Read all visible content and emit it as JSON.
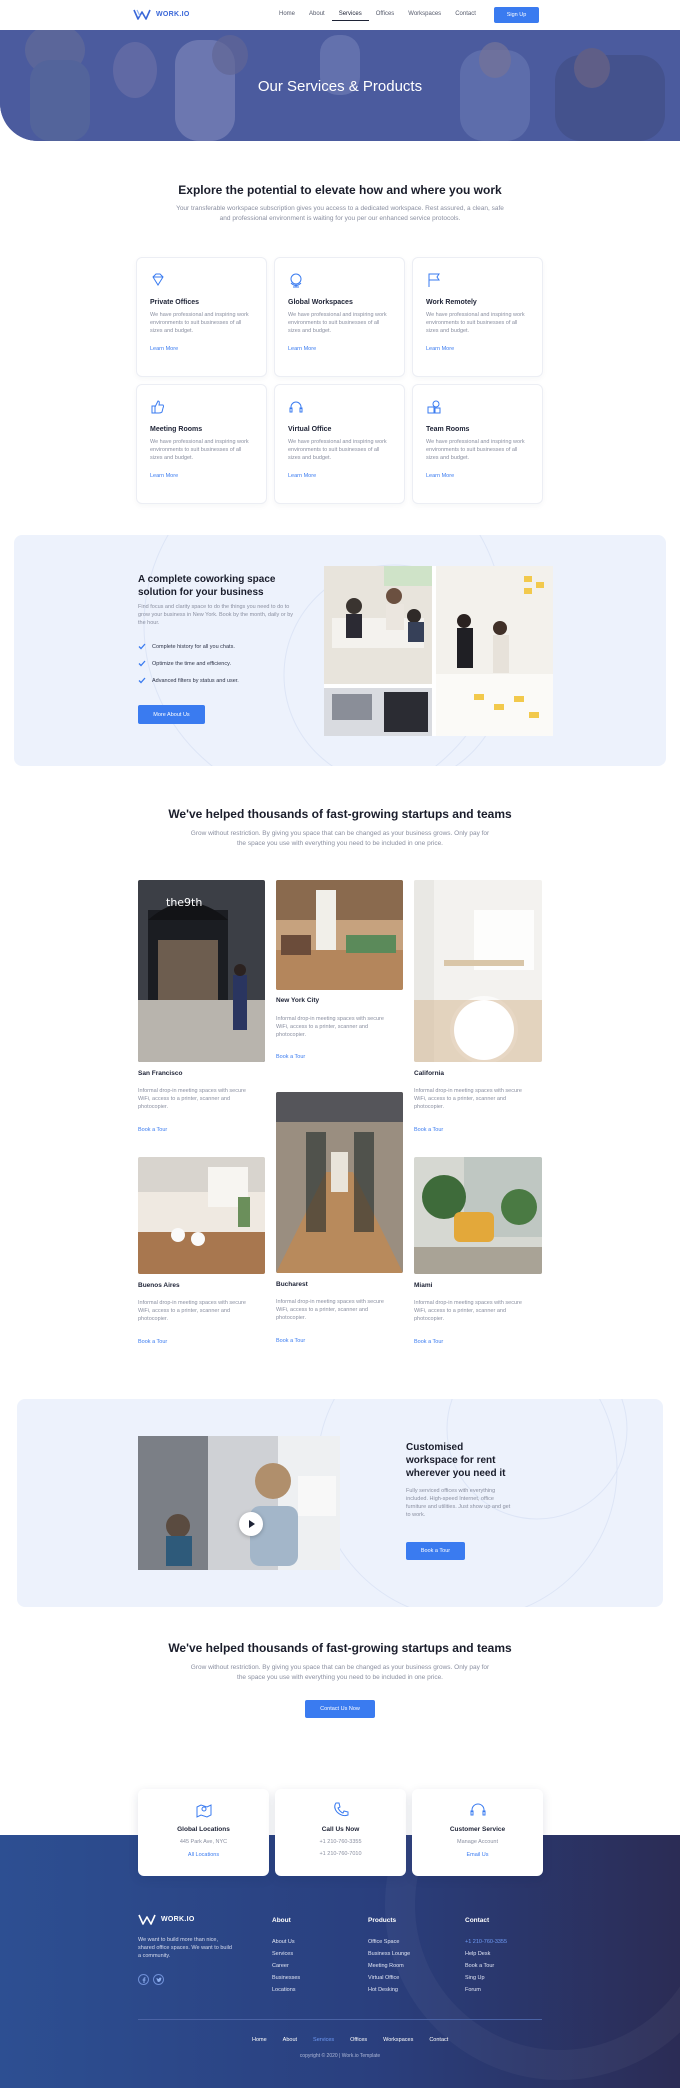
{
  "brand": {
    "name": "WORK.IO"
  },
  "nav": {
    "links": [
      "Home",
      "About",
      "Services",
      "Offices",
      "Workspaces",
      "Contact"
    ],
    "active": "Services",
    "signup": "Sign Up"
  },
  "hero": {
    "title": "Our Services & Products"
  },
  "services": {
    "title": "Explore the potential to elevate how and where you work",
    "subtitle": "Your transferable workspace subscription gives you access to a dedicated workspace. Rest assured, a clean, safe and professional environment is waiting for you per our enhanced service protocols.",
    "cards": [
      {
        "title": "Private Offices",
        "desc": "We have professional and inspiring work environments to suit businesses of all sizes and budget.",
        "link": "Learn More",
        "icon": "diamond-icon"
      },
      {
        "title": "Global Workspaces",
        "desc": "We have professional and inspiring work environments to suit businesses of all sizes and budget.",
        "link": "Learn More",
        "icon": "globe-icon"
      },
      {
        "title": "Work Remotely",
        "desc": "We have professional and inspiring work environments to suit businesses of all sizes and budget.",
        "link": "Learn More",
        "icon": "flag-icon"
      },
      {
        "title": "Meeting Rooms",
        "desc": "We have professional and inspiring work environments to suit businesses of all sizes and budget.",
        "link": "Learn More",
        "icon": "thumbs-up-icon"
      },
      {
        "title": "Virtual Office",
        "desc": "We have professional and inspiring work environments to suit businesses of all sizes and budget.",
        "link": "Learn More",
        "icon": "headset-icon"
      },
      {
        "title": "Team Rooms",
        "desc": "We have professional and inspiring work environments to suit businesses of all sizes and budget.",
        "link": "Learn More",
        "icon": "shapes-icon"
      }
    ]
  },
  "coworking": {
    "title": "A complete coworking space solution for your business",
    "desc": "Find focus and clarity space to do the things you need to do to grow your business in New York. Book by the month, daily or by the hour.",
    "checks": [
      "Complete history for all you chats.",
      "Optimize the time and efficiency.",
      "Advanced filters by status and user."
    ],
    "button": "More About Us"
  },
  "locations": {
    "title": "We've helped thousands of fast-growing startups and teams",
    "subtitle": "Grow without restriction. By giving you space that can be changed as your business grows. Only pay for the space you use with everything you need to be included in one price.",
    "items": [
      {
        "city": "San Francisco",
        "desc": "Informal drop-in meeting spaces with secure WiFi, access to a printer, scanner and photocopier.",
        "link": "Book a Tour"
      },
      {
        "city": "New York City",
        "desc": "Informal drop-in meeting spaces with secure WiFi, access to a printer, scanner and photocopier.",
        "link": "Book a Tour"
      },
      {
        "city": "California",
        "desc": "Informal drop-in meeting spaces with secure WiFi, access to a printer, scanner and photocopier.",
        "link": "Book a Tour"
      },
      {
        "city": "Buenos Aires",
        "desc": "Informal drop-in meeting spaces with secure WiFi, access to a printer, scanner and photocopier.",
        "link": "Book a Tour"
      },
      {
        "city": "Bucharest",
        "desc": "Informal drop-in meeting spaces with secure WiFi, access to a printer, scanner and photocopier.",
        "link": "Book a Tour"
      },
      {
        "city": "Miami",
        "desc": "Informal drop-in meeting spaces with secure WiFi, access to a printer, scanner and photocopier.",
        "link": "Book a Tour"
      }
    ],
    "storefront_sign": "the9th"
  },
  "customised": {
    "title": "Customised workspace for rent wherever you need it",
    "desc": "Fully serviced offices with everything included. High-speed Internet, office furniture and utilities. Just show up and get to work.",
    "button": "Book a Tour"
  },
  "cta": {
    "title": "We've helped thousands of fast-growing startups and teams",
    "subtitle": "Grow without restriction. By giving you space that can be changed as your business grows. Only pay for the space you use with everything you need to be included in one price.",
    "button": "Contact Us Now"
  },
  "contact_cards": [
    {
      "title": "Global Locations",
      "line1": "445 Park Ave, NYC",
      "link": "All Locations",
      "icon": "map-pin-icon"
    },
    {
      "title": "Call Us Now",
      "line1": "+1 210-760-3355",
      "line2": "+1 210-760-7010",
      "icon": "phone-icon"
    },
    {
      "title": "Customer Service",
      "line1": "Manage Account",
      "link": "Email Us",
      "icon": "headset-icon"
    }
  ],
  "footer": {
    "tagline": "We want to build more than nice, shared office spaces. We want to build a community.",
    "columns": [
      {
        "heading": "About",
        "items": [
          "About Us",
          "Services",
          "Career",
          "Businesses",
          "Locations"
        ]
      },
      {
        "heading": "Products",
        "items": [
          "Office Space",
          "Business Lounge",
          "Meeting Room",
          "Virtual Office",
          "Hot Desking"
        ]
      },
      {
        "heading": "Contact",
        "items": [
          "+1 210-760-3355",
          "Help Desk",
          "Book a Tour",
          "Sing Up",
          "Forum"
        ]
      }
    ],
    "nav": [
      "Home",
      "About",
      "Services",
      "Offices",
      "Workspaces",
      "Contact"
    ],
    "nav_active": "Services",
    "copyright": "copyright © 2020  |  Work.io Template"
  },
  "colors": {
    "accent": "#3a7bf0",
    "footer_start": "#2d4f92",
    "footer_end": "#2b2c55",
    "band": "#edf2fc"
  }
}
